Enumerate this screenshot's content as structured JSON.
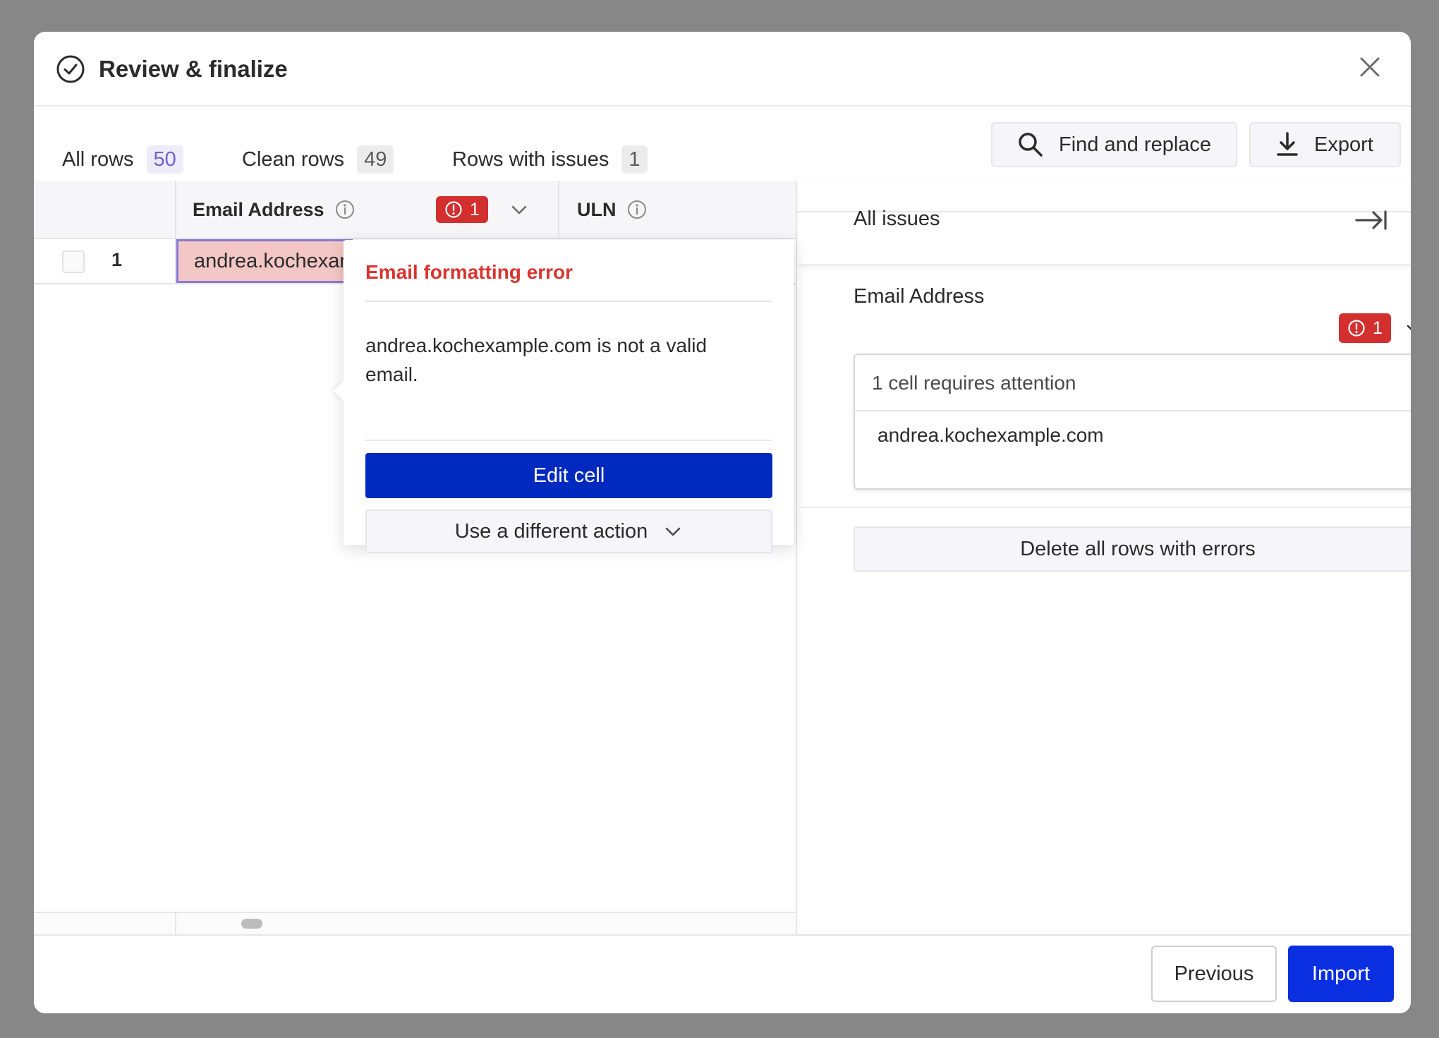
{
  "dialog": {
    "title": "Review & finalize"
  },
  "tabs": [
    {
      "label": "All rows",
      "count": "50"
    },
    {
      "label": "Clean rows",
      "count": "49"
    },
    {
      "label": "Rows with issues",
      "count": "1"
    }
  ],
  "toolbar": {
    "find_replace_label": "Find and replace",
    "export_label": "Export"
  },
  "grid": {
    "columns": [
      {
        "title": "Email Address",
        "error_count": "1"
      },
      {
        "title": "ULN"
      }
    ],
    "rows": [
      {
        "number": "1",
        "email": "andrea.kochexample.com"
      }
    ]
  },
  "popover": {
    "title": "Email formatting error",
    "message": "andrea.kochexample.com is not a valid email.",
    "primary_action": "Edit cell",
    "secondary_action": "Use a different action"
  },
  "issues_panel": {
    "title": "All issues",
    "group_title": "Email Address",
    "group_error_count": "1",
    "attention_label": "1 cell requires attention",
    "attention_item": "andrea.kochexample.com",
    "delete_label": "Delete all rows with errors"
  },
  "footer": {
    "previous_label": "Previous",
    "import_label": "Import"
  },
  "colors": {
    "accent": "#7a6bd1",
    "error": "#d32f2f",
    "primary": "#0029c0",
    "import": "#0a2fe0"
  }
}
